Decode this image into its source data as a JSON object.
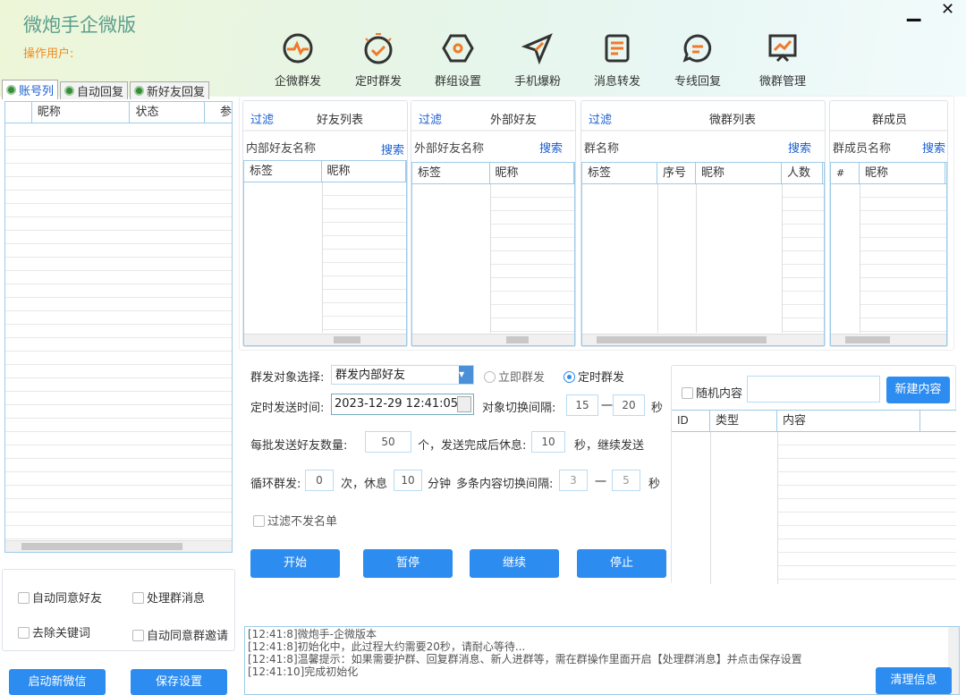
{
  "app": {
    "title": "微炮手企微版",
    "user_label": "操作用户:",
    "minimize": "▁",
    "close": "✕"
  },
  "toolbar": [
    {
      "label": "企微群发",
      "icon": "pulse-icon"
    },
    {
      "label": "定时群发",
      "icon": "timer-icon"
    },
    {
      "label": "群组设置",
      "icon": "hexagon-icon"
    },
    {
      "label": "手机爆粉",
      "icon": "paper-plane-icon"
    },
    {
      "label": "消息转发",
      "icon": "message-doc-icon"
    },
    {
      "label": "专线回复",
      "icon": "chat-icon"
    },
    {
      "label": "微群管理",
      "icon": "chart-board-icon"
    }
  ],
  "left": {
    "tabs": [
      "账号列",
      "自动回复",
      "新好友回复"
    ],
    "columns": [
      "",
      "昵称",
      "状态",
      "参"
    ],
    "checkboxes": [
      "自动同意好友",
      "处理群消息",
      "去除关键词",
      "自动同意群邀请"
    ],
    "buttons": {
      "start": "启动新微信",
      "save": "保存设置"
    }
  },
  "panels": {
    "friends": {
      "filter": "过滤",
      "title": "好友列表",
      "search_label": "内部好友名称",
      "search": "搜索",
      "columns": [
        "标签",
        "昵称"
      ]
    },
    "external": {
      "filter": "过滤",
      "title": "外部好友",
      "search_label": "外部好友名称",
      "search": "搜索",
      "columns": [
        "标签",
        "昵称"
      ]
    },
    "groups": {
      "filter": "过滤",
      "title": "微群列表",
      "search_label": "群名称",
      "search": "搜索",
      "columns": [
        "标签",
        "序号",
        "昵称",
        "人数"
      ]
    },
    "members": {
      "title": "群成员",
      "search_label": "群成员名称",
      "search": "搜索",
      "columns": [
        "#",
        "昵称"
      ]
    }
  },
  "form": {
    "target_label": "群发对象选择:",
    "target_value": "群发内部好友",
    "radio_now": "立即群发",
    "radio_timed": "定时群发",
    "time_label": "定时发送时间:",
    "time_value": "2023-12-29 12:41:05",
    "switch_label": "对象切换间隔:",
    "switch_min": "15",
    "dash": "一",
    "switch_max": "20",
    "sec": "秒",
    "batch_label": "每批发送好友数量:",
    "batch_value": "50",
    "batch_mid": "个，发送完成后休息:",
    "rest_value": "10",
    "batch_end": "秒，继续发送",
    "loop_label": "循环群发:",
    "loop_value": "0",
    "loop_mid": "次，休息",
    "loop_rest": "10",
    "loop_min_label": "分钟",
    "multi_label": "多条内容切换间隔:",
    "multi_min": "3",
    "multi_max": "5",
    "filter_cb": "过滤不发名单",
    "buttons": [
      "开始",
      "暂停",
      "继续",
      "停止"
    ]
  },
  "content": {
    "random_cb": "随机内容",
    "new_btn": "新建内容",
    "columns": [
      "ID",
      "类型",
      "内容"
    ]
  },
  "log": {
    "lines": [
      "[12:41:8]微炮手-企微版本",
      "[12:41:8]初始化中，此过程大约需要20秒，请耐心等待...",
      "[12:41:8]温馨提示：如果需要护群、回复群消息、新人进群等，需在群操作里面开启【处理群消息】并点击保存设置",
      "[12:41:10]完成初始化"
    ],
    "clear_btn": "清理信息"
  }
}
